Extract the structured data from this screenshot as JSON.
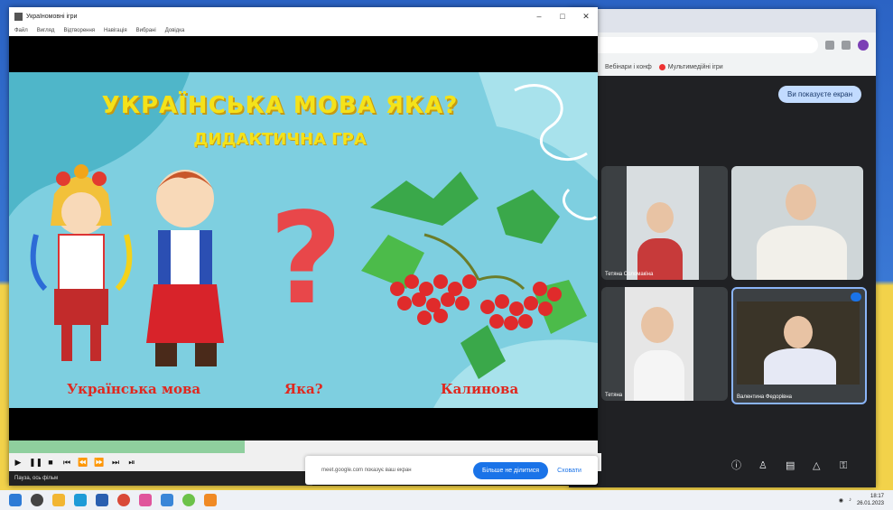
{
  "player": {
    "window_title": "Україномовні ігри",
    "menu": [
      "Файл",
      "Вигляд",
      "Відтворення",
      "Навігація",
      "Вибрані",
      "Довідка"
    ],
    "status": "Пауза, ось фільм"
  },
  "slide": {
    "title": "УКРАЇНСЬКА МОВА ЯКА?",
    "subtitle": "ДИДАКТИЧНА ГРА",
    "captions": [
      "Українська мова",
      "Яка?",
      "Калинова"
    ]
  },
  "progress": {
    "played_fraction": 0.4
  },
  "browser": {
    "bookmarks": [
      "Вебінари і конф",
      "Мультимедійні ігри"
    ],
    "meet_pill": "Ви показуєте екран"
  },
  "meet": {
    "participants": [
      "Тетяна Соломакіна",
      "",
      "Тетяна",
      "Валентина Федорівна"
    ]
  },
  "share": {
    "text": "meet.google.com показує ваш екран",
    "stop_label": "Більше не ділитися",
    "hide_label": "Сховати"
  },
  "taskbar": {
    "time": "18:17",
    "date": "26.01.2023"
  },
  "colors": {
    "title_yellow": "#f4e21a",
    "caption_red": "#e0281f",
    "meet_bg": "#202124"
  }
}
